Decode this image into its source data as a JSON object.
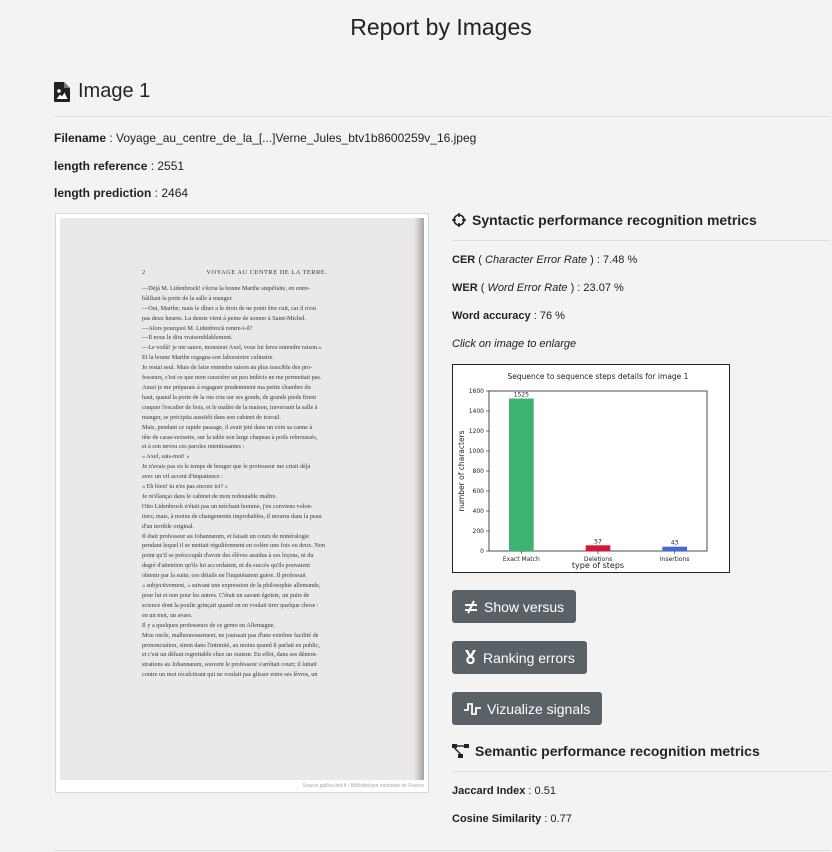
{
  "page": {
    "title": "Report by Images"
  },
  "image_section": {
    "heading": "Image 1",
    "filename_label": "Filename",
    "filename_value": " : Voyage_au_centre_de_la_[...]Verne_Jules_btv1b8600259v_16.jpeg",
    "length_reference_label": "length reference",
    "length_reference_value": " : 2551",
    "length_prediction_label": "length prediction",
    "length_prediction_value": " : 2464"
  },
  "scan": {
    "page_number": "2",
    "running_head": "VOYAGE AU CENTRE DE LA TERRE.",
    "lines": [
      "—Déjà M. Lidenbrock! s'écria la bonne Marthe stupéfaite, en entre-",
      "bâillant la porte de la salle à manger.",
      "—Oui, Marthe; mais le dîner a le droit de ne point être cuit, car il n'est",
      "pas deux heures. La demie vient à peine de sonner à Saint-Michel.",
      "—Alors pourquoi M. Lidenbrock rentre-t-il?",
      "—Il nous le dira vraisemblablement.",
      "—Le voilà! je me sauve, monsieur Axel, vous lui ferez entendre raison.»",
      "Et la bonne Marthe regagna son laboratoire culinaire.",
      "Je restai seul. Mais de faire entendre raison au plus irascible des pro-",
      "fesseurs, c'est ce que mon caractère un peu indécis ne me permettait pas.",
      "Aussi je me préparais à regagner prudemment ma petite chambre du",
      "haut, quand la porte de la rue cria sur ses gonds; de grands pieds firent",
      "craquer l'escalier de bois, et le maître de la maison, traversant la salle à",
      "manger, se précipita aussitôt dans son cabinet de travail.",
      "Mais, pendant ce rapide passage, il avait jeté dans un coin sa canne à",
      "tête de casse-noisette, sur la table son large chapeau à poils rebroussés,",
      "et à son neveu ces paroles retentissantes :",
      "« Axel, suis-moi! »",
      "Je n'avais pas eu le temps de bouger que le professeur me criait déjà",
      "avec un vif accent d'impatience :",
      "« Eh bien! tu n'es pas encore ici? »",
      "Je m'élançai dans le cabinet de mon redoutable maître.",
      "Otto Lidenbrock n'était pas un méchant homme, j'en conviens volon-",
      "tiers; mais, à moins de changements improbables, il mourra dans la peau",
      "d'un terrible original.",
      "Il était professeur au Johannæum, et faisait un cours de minéralogie",
      "pendant lequel il se mettait régulièrement en colère une fois ou deux. Non",
      "point qu'il se préoccupât d'avoir des élèves assidus à ses leçons, ni du",
      "degré d'attention qu'ils lui accordaient, ni du succès qu'ils pouvaient",
      "obtenir par la suite; ces détails ne l'inquiétaient guère. Il professait",
      "« subjectivement, » suivant une expression de la philosophie allemande,",
      "pour lui et non pour les autres. C'était un savant égoïste, un puits de",
      "science dont la poulie grinçait quand on en voulait tirer quelque chose :",
      "en un mot, un avare.",
      "Il y a quelques professeurs de ce genre en Allemagne.",
      "Mon oncle, malheureusement, ne jouissait pas d'une extrême facilité de",
      "prononciation, sinon dans l'intimité, au moins quand il parlait en public,",
      "et c'est un défaut regrettable chez un orateur. En effet, dans ses démon-",
      "strations au Johannæum, souvent le professeur s'arrêtait court; il luttait",
      "contre un mot récalcitrant qui ne voulait pas glisser entre ses lèvres, un"
    ],
    "source": "Source gallica.bnf.fr / Bibliothèque nationale de France"
  },
  "syntactic": {
    "heading": "Syntactic performance recognition metrics",
    "cer_label": "CER",
    "cer_open": " ( ",
    "cer_desc": "Character Error Rate",
    "cer_value": " ) : 7.48 %",
    "wer_label": "WER",
    "wer_open": " ( ",
    "wer_desc": "Word Error Rate",
    "wer_value": " ) : 23.07 %",
    "word_acc_label": "Word accuracy",
    "word_acc_value": " : 76 %",
    "hint": "Click on image to enlarge"
  },
  "chart_data": {
    "type": "bar",
    "title": "Sequence to sequence steps details for image 1",
    "xlabel": "type of steps",
    "ylabel": "number of characters",
    "categories": [
      "Exact Match",
      "Deletions",
      "Insertions"
    ],
    "values": [
      1525,
      57,
      43
    ],
    "data_labels": [
      "1525",
      "57",
      "43"
    ],
    "colors": [
      "#3cb371",
      "#dc143c",
      "#4169e1"
    ],
    "ylim": [
      0,
      1600
    ],
    "yticks": [
      0,
      200,
      400,
      600,
      800,
      1000,
      1200,
      1400,
      1600
    ],
    "ytick_labels": [
      "0",
      "200",
      "400",
      "600",
      "800",
      "1000",
      "1200",
      "1400",
      "1600"
    ]
  },
  "buttons": {
    "show_versus": "Show versus",
    "ranking_errors": "Ranking errors",
    "vizualize_signals": "Vizualize signals"
  },
  "semantic": {
    "heading": "Semantic performance recognition metrics",
    "jaccard_label": "Jaccard Index",
    "jaccard_value": " : 0.51",
    "cosine_label": "Cosine Similarity",
    "cosine_value": " : 0.77"
  }
}
